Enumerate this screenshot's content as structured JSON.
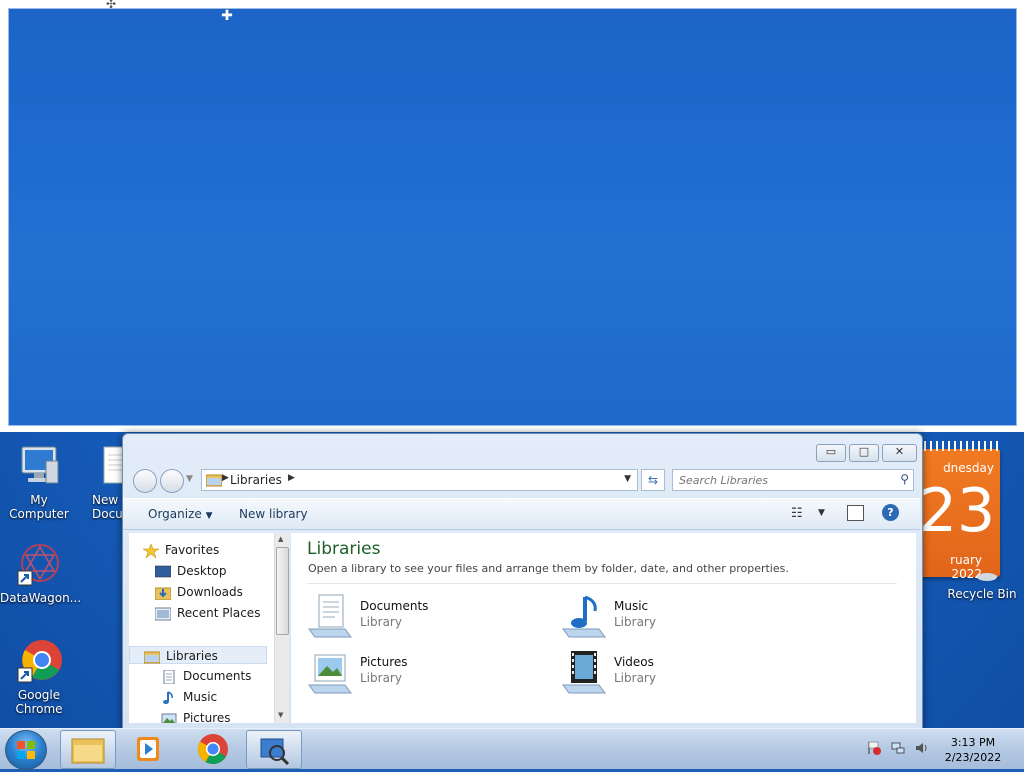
{
  "desktop": {
    "icons": [
      {
        "label": "My Computer"
      },
      {
        "label": "New Text Document",
        "visible_label": "New T\nDocum"
      },
      {
        "label": "DataWagon..."
      },
      {
        "label": "Google Chrome",
        "visible_label": "Google\nChrome"
      },
      {
        "label": "Recycle Bin"
      }
    ]
  },
  "gadget": {
    "day_partial": "dnesday",
    "date_partial": "23",
    "month_partial": "ruary 2022"
  },
  "explorer": {
    "address": {
      "crumb": "Libraries"
    },
    "search": {
      "placeholder": "Search Libraries"
    },
    "toolbar": {
      "organize": "Organize",
      "new_library": "New library"
    },
    "nav": {
      "items": [
        {
          "label": "Favorites",
          "icon": "star-icon"
        },
        {
          "label": "Desktop",
          "icon": "desktop-icon"
        },
        {
          "label": "Downloads",
          "icon": "downloads-icon"
        },
        {
          "label": "Recent Places",
          "icon": "recent-places-icon"
        },
        {
          "label": "Libraries",
          "icon": "libraries-icon"
        },
        {
          "label": "Documents",
          "icon": "documents-icon"
        },
        {
          "label": "Music",
          "icon": "music-icon"
        },
        {
          "label": "Pictures",
          "icon": "pictures-icon"
        }
      ]
    },
    "content": {
      "title": "Libraries",
      "description": "Open a library to see your files and arrange them by folder, date, and other properties.",
      "libraries": [
        {
          "name": "Documents",
          "type": "Library"
        },
        {
          "name": "Music",
          "type": "Library"
        },
        {
          "name": "Pictures",
          "type": "Library"
        },
        {
          "name": "Videos",
          "type": "Library"
        }
      ]
    },
    "window_buttons": {
      "minimize": "▭",
      "maximize": "□",
      "close": "✕"
    },
    "help": "?"
  },
  "taskbar": {
    "clock_time": "3:13 PM",
    "clock_date": "2/23/2022"
  }
}
